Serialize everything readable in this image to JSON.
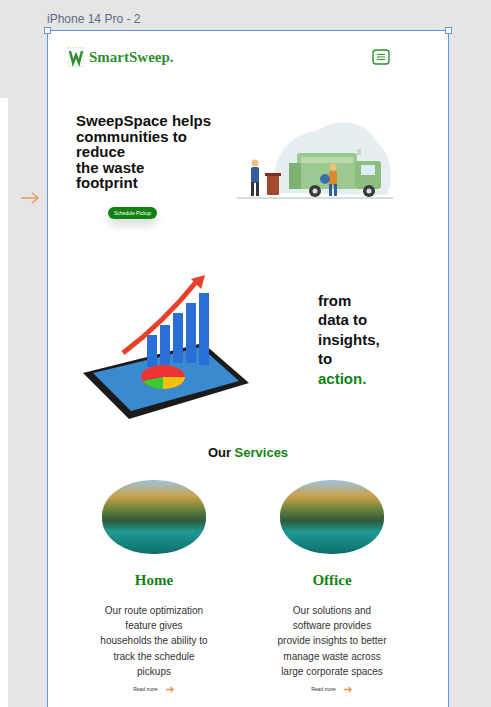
{
  "frame": {
    "label": "iPhone 14 Pro - 2"
  },
  "brand": {
    "name": "SmartSweep."
  },
  "hero": {
    "title_lines": [
      "SweepSpace helps",
      "communities to",
      "reduce",
      "the waste",
      "footprint"
    ],
    "button": "Schedule Pickup"
  },
  "insights": {
    "lines": [
      {
        "text": "from",
        "accent": false
      },
      {
        "text": "data to",
        "accent": false
      },
      {
        "text": "insights,",
        "accent": false
      },
      {
        "text": "to",
        "accent": false
      },
      {
        "text": "action.",
        "accent": true
      }
    ]
  },
  "services": {
    "heading": "Our",
    "heading_accent": "Services",
    "cards": [
      {
        "title": "Home",
        "description": "Our route optimization feature gives households the ability to track the schedule pickups",
        "link": "Read more"
      },
      {
        "title": "Office",
        "description": "Our solutions and software provides provide insights to better manage waste across large corporate spaces",
        "link": "Read more"
      }
    ]
  }
}
